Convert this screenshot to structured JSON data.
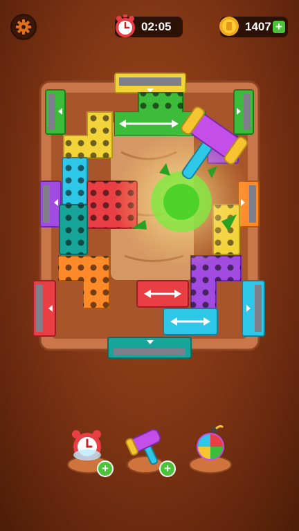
{
  "hud": {
    "timer": "02:05",
    "coins": "1407",
    "plus": "+"
  },
  "icons": {
    "settings": "gear-icon",
    "timer": "alarm-clock-icon",
    "coins": "coin-icon",
    "add_coins": "plus-icon"
  },
  "board": {
    "pieces": [
      {
        "name": "green-t-piece",
        "color": "#3dbb3a"
      },
      {
        "name": "yellow-piece",
        "color": "#f2d33a"
      },
      {
        "name": "cyan-piece",
        "color": "#2fc7e8"
      },
      {
        "name": "red-piece",
        "color": "#e83e44"
      },
      {
        "name": "teal-piece",
        "color": "#17a59a"
      },
      {
        "name": "orange-piece",
        "color": "#ff8a2a"
      },
      {
        "name": "purple-piece",
        "color": "#a24be0"
      },
      {
        "name": "small-red-piece",
        "color": "#e83e44"
      },
      {
        "name": "cyan-bar-piece",
        "color": "#2fc7e8"
      }
    ],
    "exits": [
      {
        "name": "exit-gate-top-yellow",
        "color": "#f2d33a"
      },
      {
        "name": "exit-gate-left-green",
        "color": "#3dbb3a"
      },
      {
        "name": "exit-gate-right-green",
        "color": "#3dbb3a"
      },
      {
        "name": "exit-gate-left-purple",
        "color": "#a24be0"
      },
      {
        "name": "exit-gate-right-orange",
        "color": "#ff8a2a"
      },
      {
        "name": "exit-gate-left-red",
        "color": "#e83e44"
      },
      {
        "name": "exit-gate-right-cyan",
        "color": "#2fc7e8"
      },
      {
        "name": "exit-gate-bottom-teal",
        "color": "#17a59a"
      }
    ]
  },
  "boosters": [
    {
      "name": "freeze-time-booster",
      "icon": "alarm-clock-icon",
      "plus": "+"
    },
    {
      "name": "hammer-booster",
      "icon": "hammer-icon",
      "plus": "+"
    },
    {
      "name": "bomb-booster",
      "icon": "bomb-icon"
    }
  ]
}
